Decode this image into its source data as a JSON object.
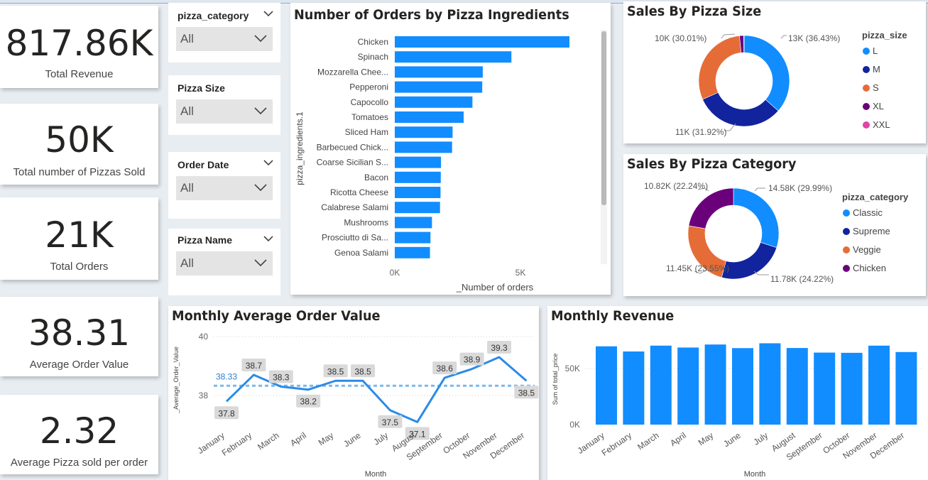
{
  "kpis": [
    {
      "value": "817.86K",
      "label": "Total Revenue"
    },
    {
      "value": "50K",
      "label": "Total number of Pizzas Sold"
    },
    {
      "value": "21K",
      "label": "Total Orders"
    },
    {
      "value": "38.31",
      "label": "Average Order Value"
    },
    {
      "value": "2.32",
      "label": "Average Pizza sold per order"
    }
  ],
  "slicers": [
    {
      "title": "pizza_category",
      "value": "All"
    },
    {
      "title": "Pizza Size",
      "value": "All"
    },
    {
      "title": "Order Date",
      "value": "All"
    },
    {
      "title": "Pizza Name",
      "value": "All"
    }
  ],
  "colors": {
    "primary": "#118dff",
    "darkblue": "#12239e",
    "orange": "#e66c37",
    "purple": "#6b007b",
    "pink": "#e044a7",
    "dashed": "#7ab8ec"
  },
  "ingredients_chart": {
    "title": "Number of Orders by Pizza Ingredients",
    "ylabel": "pizza_ingredients.1",
    "xlabel": "_Number of orders",
    "x_ticks": [
      "0K",
      "5K"
    ],
    "chart_data": {
      "type": "bar",
      "orientation": "horizontal",
      "categories": [
        "Chicken",
        "Spinach",
        "Mozzarella Chee...",
        "Pepperoni",
        "Capocollo",
        "Tomatoes",
        "Sliced Ham",
        "Barbecued Chick...",
        "Coarse Sicilian S...",
        "Bacon",
        "Ricotta Cheese",
        "Calabrese Salami",
        "Mushrooms",
        "Prosciutto di Sa...",
        "Genoa Salami"
      ],
      "values": [
        6950,
        4640,
        3500,
        3480,
        3090,
        2740,
        2300,
        2280,
        1840,
        1830,
        1820,
        1800,
        1480,
        1420,
        1400
      ],
      "xlim": [
        0,
        7000
      ]
    }
  },
  "size_chart": {
    "title": "Sales By Pizza Size",
    "legend_title": "pizza_size",
    "chart_data": {
      "type": "pie",
      "donut": true,
      "slices": [
        {
          "name": "L",
          "value": 36.43,
          "label": "13K (36.43%)",
          "color": "#118dff"
        },
        {
          "name": "M",
          "value": 31.92,
          "label": "11K (31.92%)",
          "color": "#12239e"
        },
        {
          "name": "S",
          "value": 30.01,
          "label": "10K (30.01%)",
          "color": "#e66c37"
        },
        {
          "name": "XL",
          "value": 1.51,
          "label": "",
          "color": "#6b007b"
        },
        {
          "name": "XXL",
          "value": 0.13,
          "label": "",
          "color": "#e044a7"
        }
      ]
    }
  },
  "category_chart": {
    "title": "Sales By Pizza Category",
    "legend_title": "pizza_category",
    "chart_data": {
      "type": "pie",
      "donut": true,
      "slices": [
        {
          "name": "Classic",
          "value": 29.99,
          "label": "14.58K (29.99%)",
          "color": "#118dff"
        },
        {
          "name": "Supreme",
          "value": 24.22,
          "label": "11.78K (24.22%)",
          "color": "#12239e"
        },
        {
          "name": "Veggie",
          "value": 23.55,
          "label": "11.45K (23.55%)",
          "color": "#e66c37"
        },
        {
          "name": "Chicken",
          "value": 22.24,
          "label": "10.82K (22.24%)",
          "color": "#6b007b"
        }
      ]
    }
  },
  "aov_chart": {
    "title": "Monthly Average Order Value",
    "ylabel": "_Average_Order_Value",
    "xlabel": "Month",
    "y_ticks": [
      "40",
      "38"
    ],
    "avg_label": "38.33",
    "chart_data": {
      "type": "line",
      "categories": [
        "January",
        "February",
        "March",
        "April",
        "May",
        "June",
        "July",
        "August",
        "September",
        "October",
        "November",
        "December"
      ],
      "values": [
        37.8,
        38.7,
        38.3,
        38.2,
        38.5,
        38.5,
        37.5,
        37.1,
        38.6,
        38.9,
        39.3,
        38.5
      ],
      "value_labels": [
        "37.8",
        "38.7",
        "38.3",
        "38.2",
        "38.5",
        "38.5",
        "37.5",
        "37.1",
        "38.6",
        "38.9",
        "39.3",
        "38.5"
      ],
      "average": 38.33,
      "ylim": [
        36.9,
        40
      ]
    }
  },
  "revenue_chart": {
    "title": "Monthly Revenue",
    "ylabel": "Sum of total_price",
    "xlabel": "Month",
    "y_ticks": [
      "50K",
      "0K"
    ],
    "chart_data": {
      "type": "bar",
      "categories": [
        "January",
        "February",
        "March",
        "April",
        "May",
        "June",
        "July",
        "August",
        "September",
        "October",
        "November",
        "December"
      ],
      "values": [
        69800,
        65200,
        70400,
        68700,
        71400,
        68200,
        72500,
        68300,
        64200,
        64000,
        70400,
        64700
      ],
      "ylim": [
        0,
        93000
      ]
    }
  }
}
